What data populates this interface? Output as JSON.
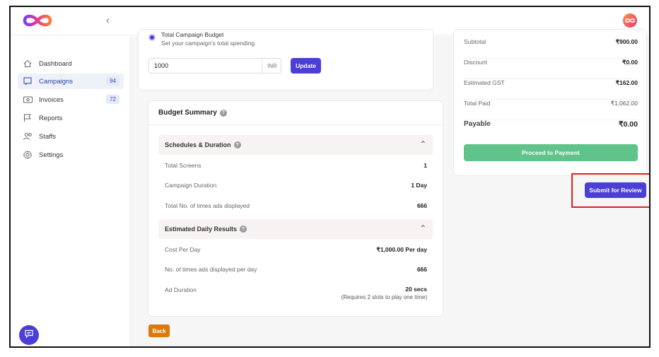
{
  "sidebar": {
    "items": [
      {
        "label": "Dashboard",
        "icon": "home-icon",
        "active": false
      },
      {
        "label": "Campaigns",
        "icon": "campaign-icon",
        "active": true,
        "badge": "94"
      },
      {
        "label": "Invoices",
        "icon": "invoice-icon",
        "active": false,
        "badge": "72"
      },
      {
        "label": "Reports",
        "icon": "flag-icon",
        "active": false
      },
      {
        "label": "Staffs",
        "icon": "users-icon",
        "active": false
      },
      {
        "label": "Settings",
        "icon": "gear-icon",
        "active": false
      }
    ]
  },
  "budget": {
    "option_label": "Total Campaign Budget",
    "option_hint": "Set your campaign's total spending.",
    "amount_value": "1000",
    "currency": "INR",
    "update_label": "Update"
  },
  "summary": {
    "title": "Budget Summary",
    "schedules": {
      "title": "Schedules & Duration",
      "rows": [
        {
          "label": "Total Screens",
          "value": "1"
        },
        {
          "label": "Campaign Duration",
          "value": "1 Day"
        },
        {
          "label": "Total No. of times ads displayed",
          "value": "666"
        }
      ]
    },
    "daily": {
      "title": "Estimated Daily Results",
      "rows": [
        {
          "label": "Cost Per Day",
          "value": "₹1,000.00 Per day"
        },
        {
          "label": "No. of times ads displayed per day",
          "value": "666"
        },
        {
          "label": "Ad Duration",
          "value": "20 secs",
          "note": "(Requires 2 slots to play one time)"
        }
      ]
    }
  },
  "back_label": "Back",
  "payment": {
    "rows": [
      {
        "label": "Subtotal",
        "value": "₹900.00"
      },
      {
        "label": "Discount",
        "value": "₹0.00"
      },
      {
        "label": "Estimated GST",
        "value": "₹162.00"
      },
      {
        "label": "Total Paid",
        "value": "₹1,062.00"
      }
    ],
    "payable_label": "Payable",
    "payable_value": "₹0.00",
    "proceed_label": "Proceed to Payment"
  },
  "submit_label": "Submit for Review",
  "colors": {
    "accent": "#4b3fd6",
    "success": "#5fc38a",
    "warning": "#d97a0c",
    "highlight": "#e02020"
  }
}
